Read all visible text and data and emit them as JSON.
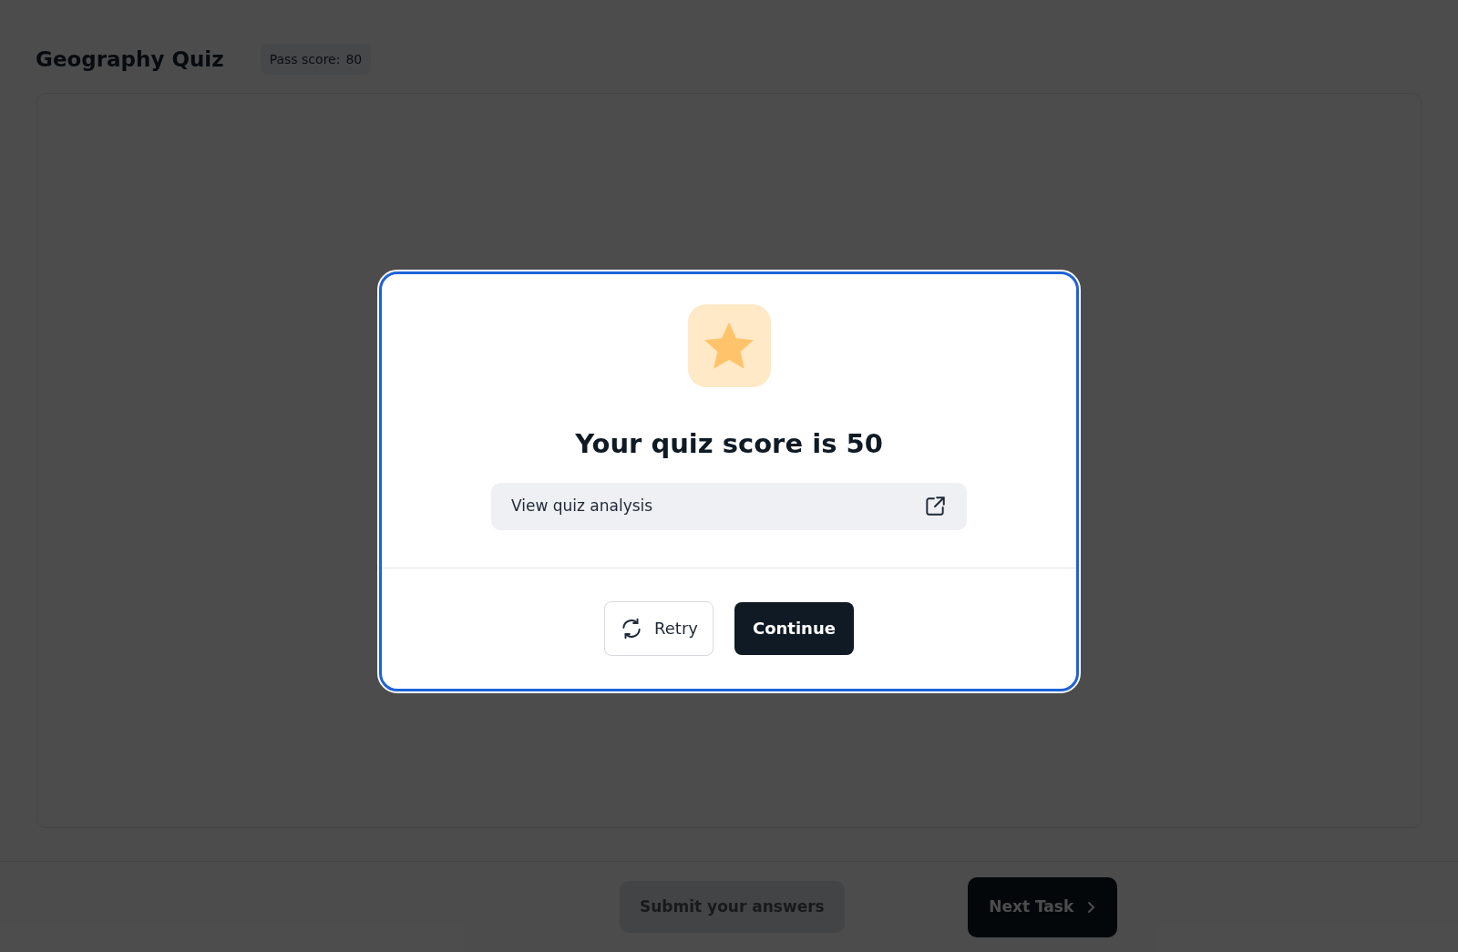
{
  "header": {
    "title": "Geography Quiz",
    "pass_score_label": "Pass score:",
    "pass_score_value": "80"
  },
  "footer": {
    "submit_button": {
      "label": "Submit your answers",
      "disabled": true
    },
    "next_button": {
      "label": "Next Task"
    }
  },
  "dialog": {
    "heading": "Your quiz score is 50",
    "analysis_link": "View quiz analysis",
    "buttons": [
      {
        "kind": "secondary",
        "label": "Retry"
      },
      {
        "kind": "primary",
        "label": "Continue"
      }
    ]
  }
}
